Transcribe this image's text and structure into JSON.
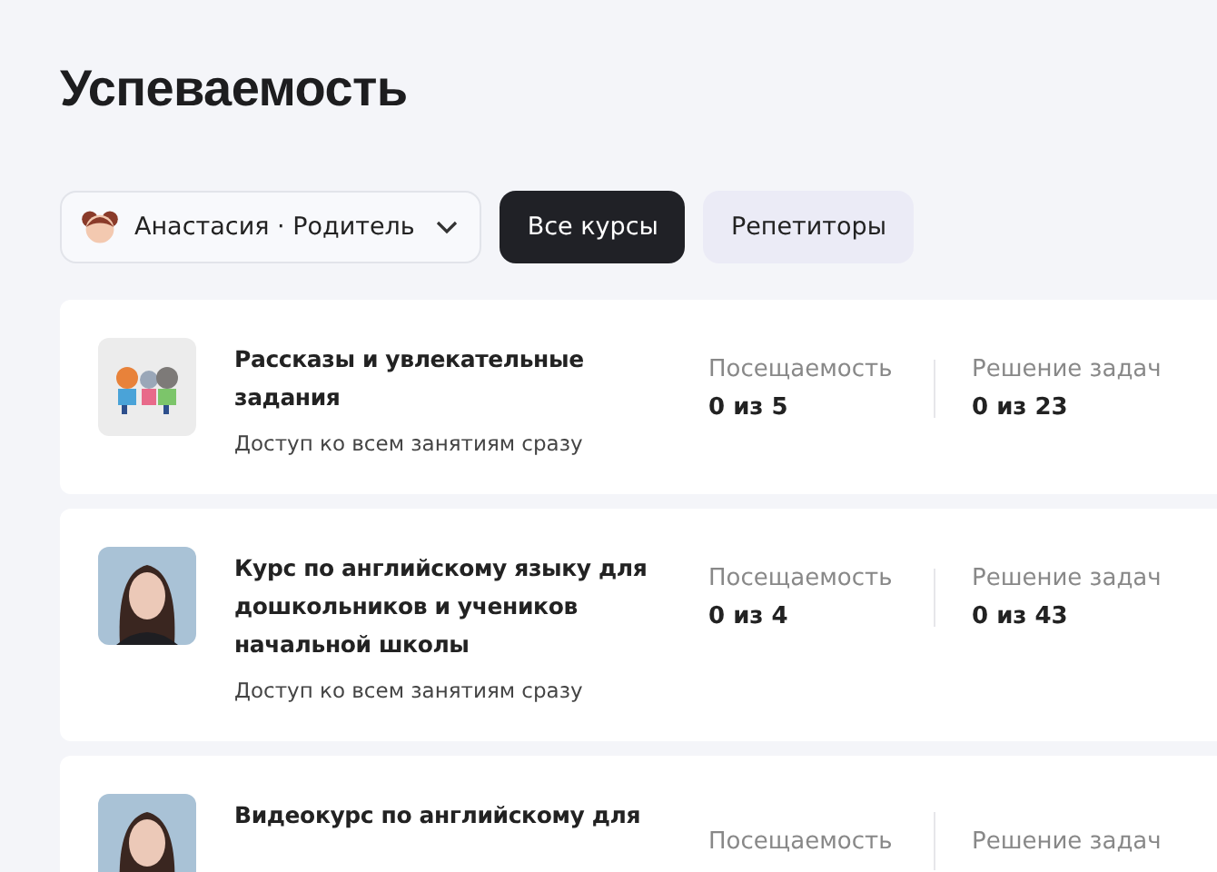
{
  "title": "Успеваемость",
  "filters": [
    {
      "kind": "profile",
      "label": "Анастасия · Родитель",
      "selected": false
    },
    {
      "kind": "tab",
      "label": "Все курсы",
      "selected": true
    },
    {
      "kind": "tab",
      "label": "Репетиторы",
      "selected": false
    }
  ],
  "courses": [
    {
      "title": "Рассказы и увлекательные задания",
      "access": "Доступ ко всем занятиям сразу",
      "stats": [
        {
          "label": "Посещаемость",
          "value": "0 из 5"
        },
        {
          "label": "Решение задач",
          "value": "0 из 23"
        }
      ]
    },
    {
      "title": "Курс по английскому языку для дошкольников и учеников начальной школы",
      "access": "Доступ ко всем занятиям сразу",
      "stats": [
        {
          "label": "Посещаемость",
          "value": "0 из 4"
        },
        {
          "label": "Решение задач",
          "value": "0 из 43"
        }
      ]
    },
    {
      "title": "Видеокурс по английскому для",
      "stats": [
        {
          "label": "Посещаемость"
        },
        {
          "label": "Решение задач"
        }
      ]
    }
  ]
}
